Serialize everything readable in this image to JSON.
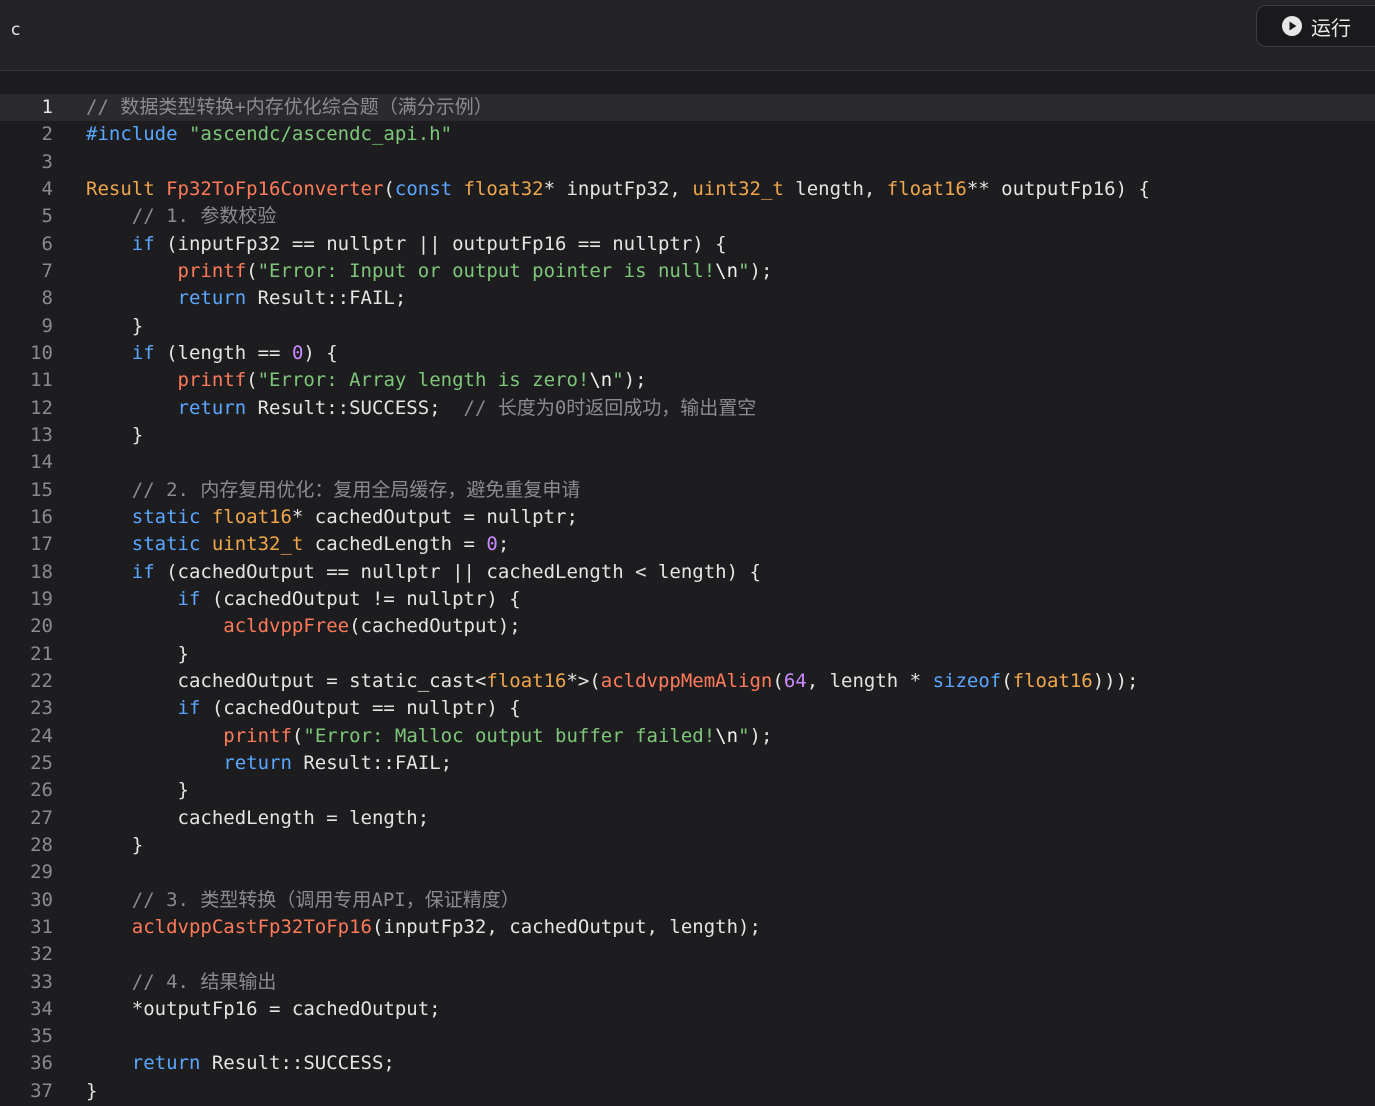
{
  "header": {
    "language": "c",
    "run_label": "运行"
  },
  "editor": {
    "active_line": 1,
    "lines": [
      [
        [
          "cm",
          "// 数据类型转换+内存优化综合题（满分示例）"
        ]
      ],
      [
        [
          "pp",
          "#include "
        ],
        [
          "st",
          "\"ascendc/ascendc_api.h\""
        ]
      ],
      [],
      [
        [
          "ty",
          "Result "
        ],
        [
          "fn",
          "Fp32ToFp16Converter"
        ],
        [
          "p",
          "("
        ],
        [
          "kw",
          "const "
        ],
        [
          "ty",
          "float32"
        ],
        [
          "p",
          "* inputFp32, "
        ],
        [
          "ty",
          "uint32_t"
        ],
        [
          "p",
          " length, "
        ],
        [
          "ty",
          "float16"
        ],
        [
          "p",
          "** outputFp16) {"
        ]
      ],
      [
        [
          "p",
          "    "
        ],
        [
          "cm",
          "// 1. 参数校验"
        ]
      ],
      [
        [
          "p",
          "    "
        ],
        [
          "kw",
          "if"
        ],
        [
          "p",
          " (inputFp32 == nullptr || outputFp16 == nullptr) {"
        ]
      ],
      [
        [
          "p",
          "        "
        ],
        [
          "fn",
          "printf"
        ],
        [
          "p",
          "("
        ],
        [
          "st",
          "\"Error: Input or output pointer is null!"
        ],
        [
          "es",
          "\\n"
        ],
        [
          "st",
          "\""
        ],
        [
          "p",
          ");"
        ]
      ],
      [
        [
          "p",
          "        "
        ],
        [
          "kw",
          "return"
        ],
        [
          "p",
          " Result::FAIL;"
        ]
      ],
      [
        [
          "p",
          "    }"
        ]
      ],
      [
        [
          "p",
          "    "
        ],
        [
          "kw",
          "if"
        ],
        [
          "p",
          " (length == "
        ],
        [
          "nu",
          "0"
        ],
        [
          "p",
          ") {"
        ]
      ],
      [
        [
          "p",
          "        "
        ],
        [
          "fn",
          "printf"
        ],
        [
          "p",
          "("
        ],
        [
          "st",
          "\"Error: Array length is zero!"
        ],
        [
          "es",
          "\\n"
        ],
        [
          "st",
          "\""
        ],
        [
          "p",
          ");"
        ]
      ],
      [
        [
          "p",
          "        "
        ],
        [
          "kw",
          "return"
        ],
        [
          "p",
          " Result::SUCCESS;  "
        ],
        [
          "cm",
          "// 长度为0时返回成功，输出置空"
        ]
      ],
      [
        [
          "p",
          "    }"
        ]
      ],
      [],
      [
        [
          "p",
          "    "
        ],
        [
          "cm",
          "// 2. 内存复用优化：复用全局缓存，避免重复申请"
        ]
      ],
      [
        [
          "p",
          "    "
        ],
        [
          "kw",
          "static "
        ],
        [
          "ty",
          "float16"
        ],
        [
          "p",
          "* cachedOutput = nullptr;"
        ]
      ],
      [
        [
          "p",
          "    "
        ],
        [
          "kw",
          "static "
        ],
        [
          "ty",
          "uint32_t"
        ],
        [
          "p",
          " cachedLength = "
        ],
        [
          "nu",
          "0"
        ],
        [
          "p",
          ";"
        ]
      ],
      [
        [
          "p",
          "    "
        ],
        [
          "kw",
          "if"
        ],
        [
          "p",
          " (cachedOutput == nullptr || cachedLength < length) {"
        ]
      ],
      [
        [
          "p",
          "        "
        ],
        [
          "kw",
          "if"
        ],
        [
          "p",
          " (cachedOutput != nullptr) {"
        ]
      ],
      [
        [
          "p",
          "            "
        ],
        [
          "fn",
          "acldvppFree"
        ],
        [
          "p",
          "(cachedOutput);"
        ]
      ],
      [
        [
          "p",
          "        }"
        ]
      ],
      [
        [
          "p",
          "        cachedOutput = static_cast<"
        ],
        [
          "ty",
          "float16"
        ],
        [
          "p",
          "*>("
        ],
        [
          "fn",
          "acldvppMemAlign"
        ],
        [
          "p",
          "("
        ],
        [
          "nu",
          "64"
        ],
        [
          "p",
          ", length * "
        ],
        [
          "kw",
          "sizeof"
        ],
        [
          "p",
          "("
        ],
        [
          "ty",
          "float16"
        ],
        [
          "p",
          ")));"
        ]
      ],
      [
        [
          "p",
          "        "
        ],
        [
          "kw",
          "if"
        ],
        [
          "p",
          " (cachedOutput == nullptr) {"
        ]
      ],
      [
        [
          "p",
          "            "
        ],
        [
          "fn",
          "printf"
        ],
        [
          "p",
          "("
        ],
        [
          "st",
          "\"Error: Malloc output buffer failed!"
        ],
        [
          "es",
          "\\n"
        ],
        [
          "st",
          "\""
        ],
        [
          "p",
          ");"
        ]
      ],
      [
        [
          "p",
          "            "
        ],
        [
          "kw",
          "return"
        ],
        [
          "p",
          " Result::FAIL;"
        ]
      ],
      [
        [
          "p",
          "        }"
        ]
      ],
      [
        [
          "p",
          "        cachedLength = length;"
        ]
      ],
      [
        [
          "p",
          "    }"
        ]
      ],
      [],
      [
        [
          "p",
          "    "
        ],
        [
          "cm",
          "// 3. 类型转换（调用专用API，保证精度）"
        ]
      ],
      [
        [
          "p",
          "    "
        ],
        [
          "fn",
          "acldvppCastFp32ToFp16"
        ],
        [
          "p",
          "(inputFp32, cachedOutput, length);"
        ]
      ],
      [],
      [
        [
          "p",
          "    "
        ],
        [
          "cm",
          "// 4. 结果输出"
        ]
      ],
      [
        [
          "p",
          "    *outputFp16 = cachedOutput;"
        ]
      ],
      [],
      [
        [
          "p",
          "    "
        ],
        [
          "kw",
          "return"
        ],
        [
          "p",
          " Result::SUCCESS;"
        ]
      ],
      [
        [
          "p",
          "}"
        ]
      ]
    ]
  }
}
